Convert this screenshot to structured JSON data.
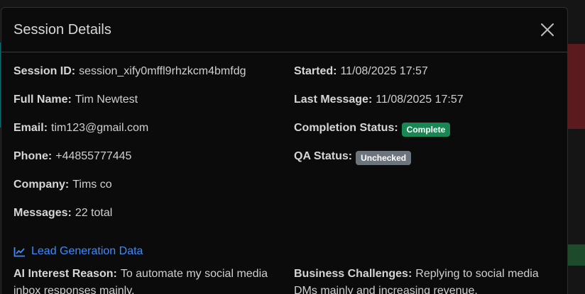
{
  "modal": {
    "title": "Session Details"
  },
  "details": {
    "session_id": {
      "label": "Session ID:",
      "value": "session_xify0mffl9rhzkcm4bmfdg"
    },
    "full_name": {
      "label": "Full Name:",
      "value": "Tim Newtest"
    },
    "email": {
      "label": "Email:",
      "value": "tim123@gmail.com"
    },
    "phone": {
      "label": "Phone:",
      "value": "+44855777445"
    },
    "company": {
      "label": "Company:",
      "value": "Tims co"
    },
    "messages": {
      "label": "Messages:",
      "value": "22 total"
    },
    "started": {
      "label": "Started:",
      "value": "11/08/2025 17:57"
    },
    "last_message": {
      "label": "Last Message:",
      "value": "11/08/2025 17:57"
    },
    "completion_status": {
      "label": "Completion Status:",
      "value": "Complete",
      "color": "#198754"
    },
    "qa_status": {
      "label": "QA Status:",
      "value": "Unchecked",
      "color": "#6c757d"
    }
  },
  "lead_generation": {
    "heading": "Lead Generation Data",
    "icon": "chart-line-icon",
    "accent": "#3d8bfd",
    "ai_interest": {
      "label": "AI Interest Reason:",
      "value": "To automate my social media inbox responses mainly."
    },
    "business_challenges": {
      "label": "Business Challenges:",
      "value": "Replying to social media DMs mainly and increasing revenue."
    }
  }
}
